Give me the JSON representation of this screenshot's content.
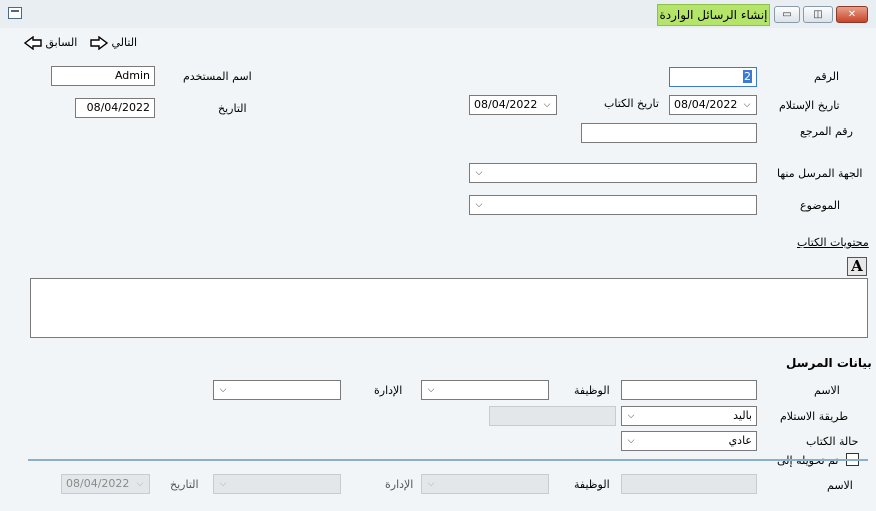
{
  "window": {
    "title": "إنشاء الرسائل الواردة",
    "minimize": "▭",
    "restore": "◫",
    "close": "✕"
  },
  "nav": {
    "next": "التالي",
    "prev": "السابق"
  },
  "form": {
    "number_label": "الرقم",
    "number_value": "2",
    "receipt_date_label": "تاريخ الإستلام",
    "receipt_date_value": "08/04/2022",
    "letter_date_label": "تاريخ الكتاب",
    "letter_date_value": "08/04/2022",
    "reference_label": "رقم المرجع",
    "reference_value": "",
    "sender_entity_label": "الجهة المرسل منها",
    "sender_entity_value": "",
    "subject_label": "الموضوع",
    "subject_value": "",
    "username_label": "اسم المستخدم",
    "username_value": "Admin",
    "date_label": "التاريخ",
    "date_value": "08/04/2022",
    "contents_label": "محتويات الكتاب",
    "font_button": "A"
  },
  "sender": {
    "section_title": "بيانات المرسل",
    "name_label": "الاسم",
    "name_value": "",
    "job_label": "الوظيفة",
    "job_value": "",
    "dept_label": "الإدارة",
    "dept_value": "",
    "receipt_method_label": "طريقة الاستلام",
    "receipt_method_value": "باليد",
    "letter_status_label": "حالة الكتاب",
    "letter_status_value": "عادي",
    "transferred_label": "تم تحويله إلى",
    "transferred_checked": false
  },
  "transfer": {
    "name_label": "الاسم",
    "job_label": "الوظيفة",
    "dept_label": "الإدارة",
    "date_label": "التاريخ",
    "date_value": "08/04/2022"
  },
  "colors": {
    "title_highlight": "#b4e46a",
    "separator": "#8ab0c8",
    "focus_border": "#3a7bd5"
  }
}
